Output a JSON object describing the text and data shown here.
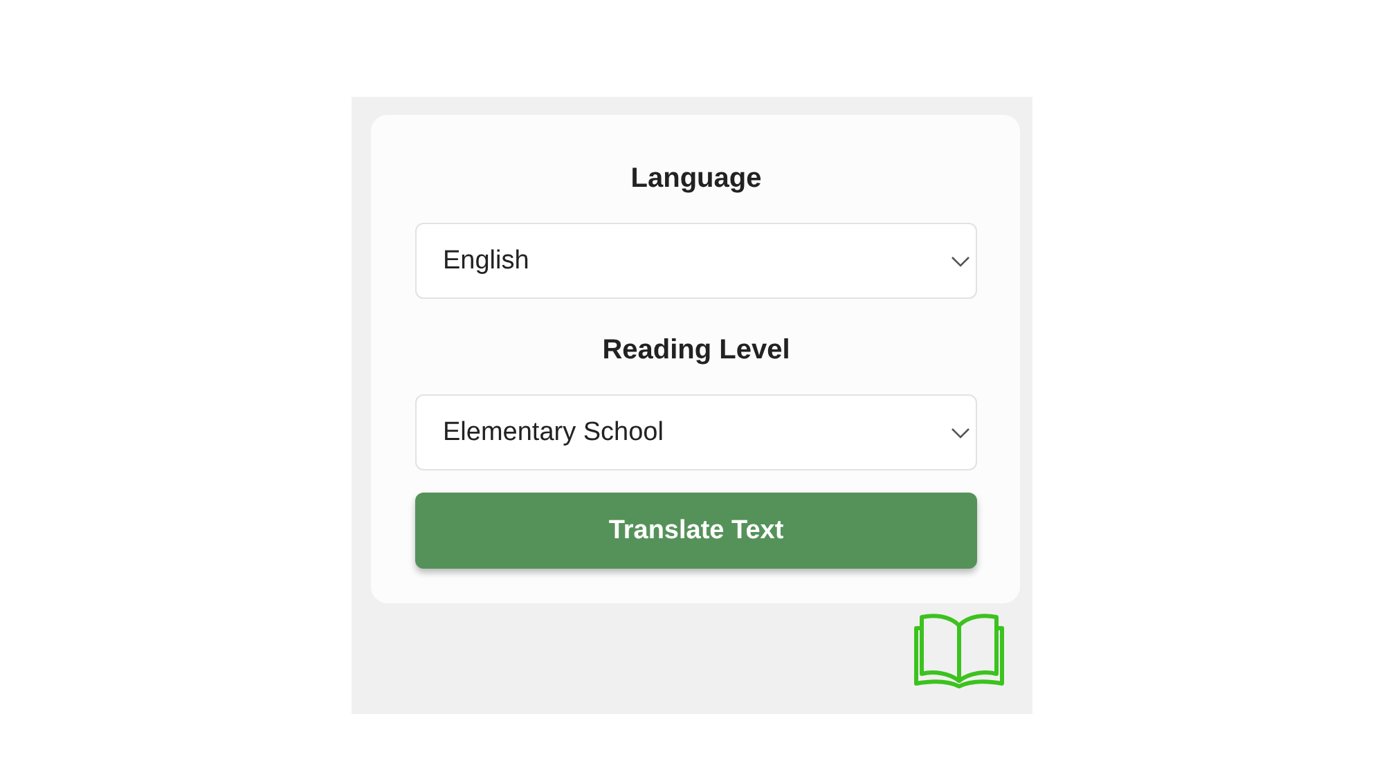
{
  "form": {
    "fields": [
      {
        "label": "Language",
        "value": "English"
      },
      {
        "label": "Reading Level",
        "value": "Elementary School"
      }
    ],
    "button": "Translate Text"
  }
}
